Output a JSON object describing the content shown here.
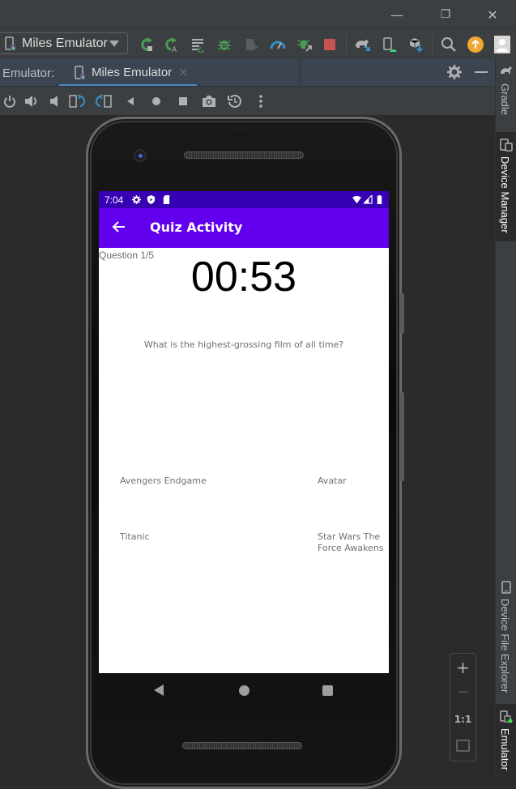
{
  "window": {
    "controls": {
      "minimize": "—",
      "restore": "❐",
      "close": "✕"
    }
  },
  "toolbar": {
    "device_selector": "Miles Emulator",
    "icons": [
      "rerun-icon",
      "apply-changes-icon",
      "apply-code-changes-icon",
      "debug-icon",
      "attach-debugger-icon",
      "profile-icon",
      "attach-debugger-to-process-icon",
      "stop-icon",
      "sync-gradle-icon",
      "device-manager-icon",
      "sdk-manager-icon",
      "search-icon",
      "update-icon",
      "account-icon"
    ],
    "colors": {
      "run_green": "#499c54",
      "stop_red": "#c75450",
      "profile_blue": "#3592c4",
      "update_orange": "#f0a732"
    }
  },
  "emulator_panel": {
    "label": "Emulator:",
    "tab": {
      "label": "Miles Emulator",
      "close": "×"
    },
    "controls": [
      "power-icon",
      "volume-up-icon",
      "volume-down-icon",
      "rotate-left-icon",
      "rotate-right-icon",
      "back-icon",
      "home-icon",
      "overview-icon",
      "screenshot-icon",
      "snapshot-icon",
      "more-icon"
    ]
  },
  "side_tabs": {
    "gradle": "Gradle",
    "device_manager": "Device Manager",
    "device_file_explorer": "Device File Explorer",
    "emulator": "Emulator"
  },
  "zoom_controls": {
    "zoom_in": "+",
    "zoom_out": "−",
    "actual_size": "1:1",
    "fit": "fit-screen-icon"
  },
  "device": {
    "status_bar": {
      "time": "7:04",
      "icons": [
        "settings-icon",
        "play-protect-icon",
        "sd-card-icon",
        "wifi-icon",
        "signal-icon",
        "battery-icon"
      ]
    },
    "app_bar": {
      "title": "Quiz Activity",
      "back": "arrow-back-icon"
    },
    "quiz": {
      "question_counter": "Question 1/5",
      "timer": "00:53",
      "question": "What is the highest-grossing film of all time?",
      "answers": [
        "Avengers Endgame",
        "Avatar",
        "Titanic",
        "Star Wars The Force Awakens"
      ]
    },
    "colors": {
      "status_bar": "#3700b3",
      "app_bar": "#6200ee"
    }
  }
}
